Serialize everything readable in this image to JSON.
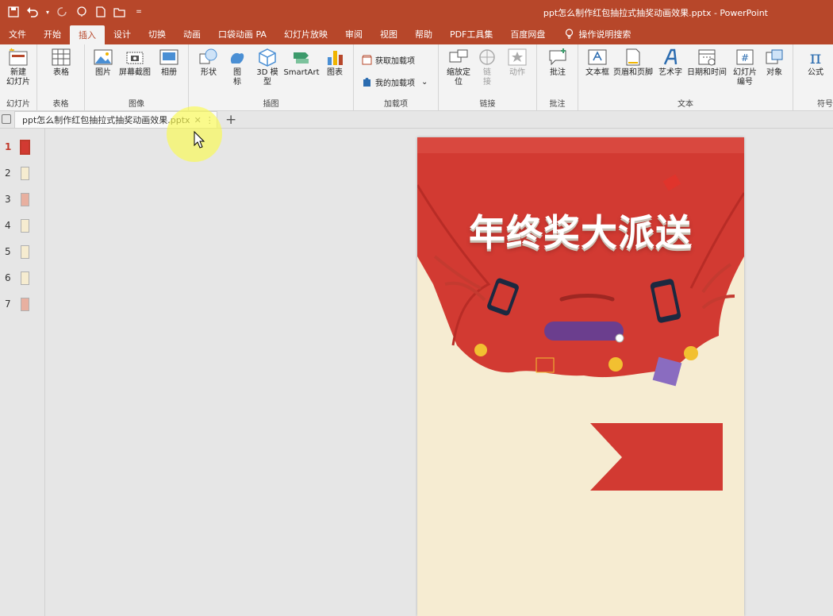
{
  "app": {
    "doc_title": "ppt怎么制作红包抽拉式抽奖动画效果.pptx  -  PowerPoint"
  },
  "quick_access": {
    "icons": [
      "save-icon",
      "undo-icon",
      "redo-icon",
      "present-icon",
      "new-icon",
      "open-icon",
      "customize-icon"
    ]
  },
  "ribbon_tabs": [
    "文件",
    "开始",
    "插入",
    "设计",
    "切换",
    "动画",
    "口袋动画 PA",
    "幻灯片放映",
    "审阅",
    "视图",
    "帮助",
    "PDF工具集",
    "百度网盘"
  ],
  "active_tab": "插入",
  "tell_me": "操作说明搜索",
  "ribbon": {
    "slides": {
      "label": "幻灯片",
      "new_slide": "新建\n幻灯片"
    },
    "tables": {
      "label": "表格",
      "table": "表格"
    },
    "images": {
      "label": "图像",
      "picture": "图片",
      "screenshot": "屏幕截图",
      "album": "相册"
    },
    "illustrations": {
      "label": "插图",
      "shapes": "形状",
      "icons": "图\n标",
      "model3d": "3D 模\n型",
      "smartart": "SmartArt",
      "chart": "图表"
    },
    "addins": {
      "label": "加载项",
      "get": "获取加载项",
      "mine": "我的加载项"
    },
    "links": {
      "label": "链接",
      "zoom": "缩放定\n位",
      "link": "链\n接",
      "action": "动作"
    },
    "comments": {
      "label": "批注",
      "comment": "批注"
    },
    "text": {
      "label": "文本",
      "textbox": "文本框",
      "header_footer": "页眉和页脚",
      "wordart": "艺术字",
      "datetime": "日期和时间",
      "slide_number": "幻灯片\n编号",
      "object": "对象"
    },
    "symbols": {
      "label": "符号",
      "equation": "公式"
    }
  },
  "doc_tab": {
    "name": "ppt怎么制作红包抽拉式抽奖动画效果.pptx"
  },
  "thumbnails": [
    "1",
    "2",
    "3",
    "4",
    "5",
    "6",
    "7"
  ],
  "selected_slide": "1",
  "slide": {
    "headline": "年终奖大派送"
  },
  "colors": {
    "accent": "#b7472a",
    "red": "#d23a32",
    "cream": "#f6ecd2",
    "purple": "#6b3e8e"
  }
}
